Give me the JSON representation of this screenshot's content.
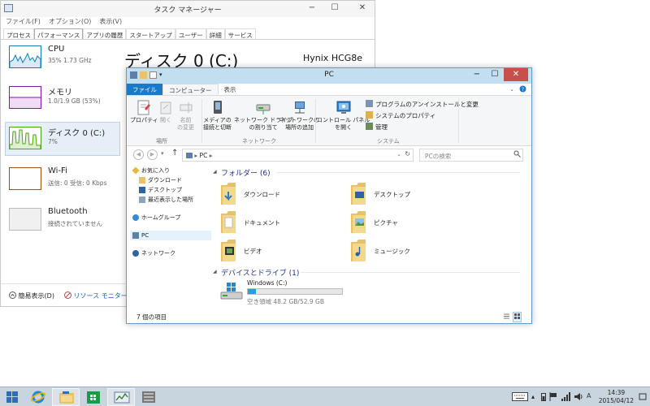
{
  "task_manager": {
    "title": "タスク マネージャー",
    "window_buttons": [
      "−",
      "☐",
      "✕"
    ],
    "menu": [
      "ファイル(F)",
      "オプション(O)",
      "表示(V)"
    ],
    "tabs": [
      "プロセス",
      "パフォーマンス",
      "アプリの履歴",
      "スタートアップ",
      "ユーザー",
      "詳細",
      "サービス"
    ],
    "active_tab": "パフォーマンス",
    "perf_items": [
      {
        "name": "CPU",
        "value": "35% 1.73 GHz",
        "color": "#117dbb"
      },
      {
        "name": "メモリ",
        "value": "1.0/1.9 GB (53%)",
        "color": "#8b12ae"
      },
      {
        "name": "ディスク 0 (C:)",
        "value": "7%",
        "color": "#4da60c"
      },
      {
        "name": "Wi-Fi",
        "value": "送信: 0 受信: 0 Kbps",
        "color": "#a74f01"
      },
      {
        "name": "Bluetooth",
        "value": "接続されていません",
        "color": "#a74f01"
      }
    ],
    "main_title": "ディスク 0 (C:)",
    "model": "Hynix HCG8e",
    "footer_simple": "簡易表示(D)",
    "footer_monitor": "リソース モニターを開"
  },
  "explorer": {
    "title": "PC",
    "ribbon_tabs": [
      "ファイル",
      "コンピューター",
      "表示"
    ],
    "ribbon": {
      "properties": "プロパティ",
      "open": "開く",
      "rename_1": "名前",
      "rename_2": "の変更",
      "media_1": "メディアの",
      "media_2": "接続と切断",
      "netdrive_1": "ネットワーク ドライブ",
      "netdrive_2": "の割り当て",
      "netloc_1": "ネットワークの",
      "netloc_2": "場所の追加",
      "control_1": "コントロール パネル",
      "control_2": "を開く",
      "uninstall": "プログラムのアンインストールと変更",
      "sysprops": "システムのプロパティ",
      "manage": "管理",
      "group_location": "場所",
      "group_network": "ネットワーク",
      "group_system": "システム"
    },
    "address": {
      "path": "PC",
      "search_placeholder": "PCの検索"
    },
    "nav": {
      "favorites": "お気に入り",
      "downloads": "ダウンロード",
      "desktop": "デスクトップ",
      "recent": "最近表示した場所",
      "homegroup": "ホームグループ",
      "pc": "PC",
      "network": "ネットワーク"
    },
    "folders_header": "フォルダー (6)",
    "folders": [
      "ダウンロード",
      "デスクトップ",
      "ドキュメント",
      "ピクチャ",
      "ビデオ",
      "ミュージック"
    ],
    "devices_header": "デバイスとドライブ (1)",
    "drive": {
      "name": "Windows (C:)",
      "space": "空き領域 48.2 GB/52.9 GB",
      "used_fraction": 0.09
    },
    "status": "7 個の項目"
  },
  "taskbar": {
    "time": "14:39",
    "date": "2015/04/12"
  },
  "colors": {
    "file_tab": "#1979ca",
    "close": "#c7504b",
    "explorer_title": "#c2dff2"
  }
}
